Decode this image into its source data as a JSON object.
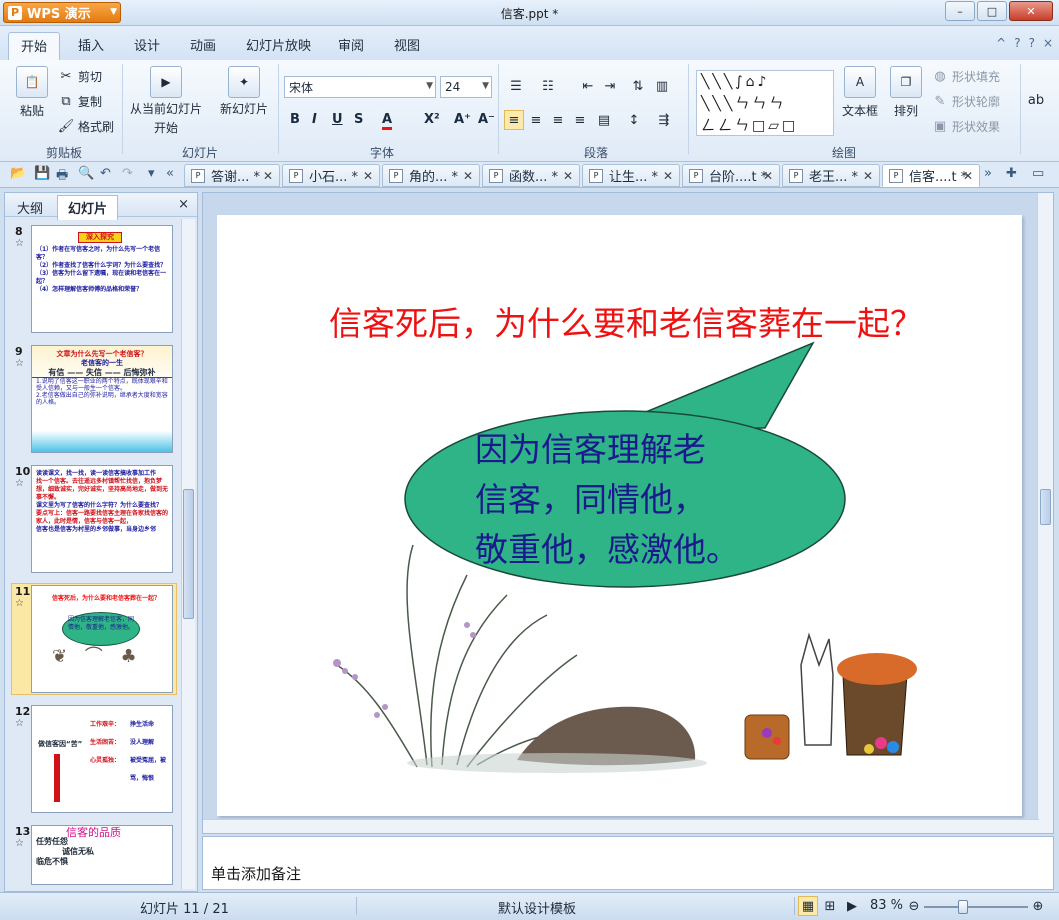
{
  "window": {
    "app_badge": "WPS 演示",
    "title": "信客.ppt *",
    "min": "–",
    "max": "□",
    "close": "✕"
  },
  "ribbon_tabs": [
    "开始",
    "插入",
    "设计",
    "动画",
    "幻灯片放映",
    "审阅",
    "视图"
  ],
  "ribbon_right": [
    "^",
    "?",
    "?",
    "×"
  ],
  "ribbon": {
    "clipboard": {
      "paste": "粘贴",
      "cut": "剪切",
      "copy": "复制",
      "format_painter": "格式刷",
      "label": "剪贴板"
    },
    "slides": {
      "from_current": "从当前幻灯片",
      "from_current_sub": "开始",
      "new_slide": "新幻灯片",
      "label": "幻灯片"
    },
    "font": {
      "family": "宋体",
      "size": "24",
      "label": "字体",
      "bold": "B",
      "italic": "I",
      "underline": "U",
      "shadow": "S",
      "color": "A",
      "superscript": "X²",
      "grow": "A⁺",
      "shrink": "A⁻"
    },
    "paragraph": {
      "label": "段落"
    },
    "drawing": {
      "textbox": "文本框",
      "arrange": "排列",
      "shape_fill": "形状填充",
      "shape_outline": "形状轮廓",
      "shape_effect": "形状效果",
      "label": "绘图"
    }
  },
  "doc_tabs": [
    {
      "label": "答谢... *"
    },
    {
      "label": "小石... *"
    },
    {
      "label": "角的... *"
    },
    {
      "label": "函数... *"
    },
    {
      "label": "让生... *"
    },
    {
      "label": "台阶....t *"
    },
    {
      "label": "老王... *"
    },
    {
      "label": "信客....t *"
    }
  ],
  "left_panel": {
    "tab_outline": "大纲",
    "tab_slides": "幻灯片",
    "close": "×",
    "thumbs": [
      {
        "num": "8",
        "title": "深入探究",
        "lines": [
          "（1）作者在写信客之时，为什么先写一个老信客？",
          "（2）作者查找了信客什么字词？为什么要查找？",
          "（3）信客为什么留下遗嘱，现在读和老信客在一起？",
          "（4）怎样理解信客师傅的品格和荣誉？"
        ]
      },
      {
        "num": "9",
        "title": "文章为什么先写一个老信客？",
        "subtitle": "老信客的一生",
        "line2": "有信 —— 失信 —— 后悔弥补",
        "lines": [
          "1.说明了信客这一职业的两个特点，既体现艰辛和受人信赖，又与一般生一个信客。",
          "2.老信客做出自己的弥补说明，继承者大度和宽容的人格。"
        ]
      },
      {
        "num": "10",
        "lines": [
          "读读课文，找一找，读一读信客搞收事加工作",
          "找一个信客。去往遥远多村镇帮忙找信，抱负梦想，细致诚实，完好诚实，坚持高尚地走，做到无事不懈。",
          "课文里为写了信客的什么字符？为什么要查找？",
          "要点写上：信客一路要找信客主理在各家找信客的家人，此时是情，信客与信客一起，",
          "信客也是信客为村里的乡邻做事，当身边乡邻"
        ]
      },
      {
        "num": "11",
        "question": "信客死后，为什么要和老信客葬在一起？",
        "answer": "因为信客理解老信客，同情他，敬重他，感激他。"
      },
      {
        "num": "12",
        "left": "做信客因“苦”",
        "items": [
          "工作艰辛：",
          "生活困苦：",
          "心灵孤独："
        ],
        "results": [
          "挣生活命",
          "没人理解",
          "被受冤屈，被骂，悔恨"
        ]
      },
      {
        "num": "13",
        "title": "信客的品质",
        "lines": [
          "任劳任怨",
          "诚信无私",
          "临危不惧"
        ]
      }
    ]
  },
  "slide": {
    "question": "信客死后，为什么要和老信客葬在一起？",
    "bubble_lines": [
      "因为信客理解老",
      "信客，同情他，",
      "敬重他，感激他。"
    ]
  },
  "notes_placeholder": "单击添加备注",
  "status": {
    "slide_index": "幻灯片 11 / 21",
    "template": "默认设计模板",
    "zoom": "83 %"
  },
  "colors": {
    "accent": "#e37b10",
    "question_red": "#ee1111",
    "bubble_fill": "#2fb487",
    "bubble_text": "#1a1a8e"
  }
}
